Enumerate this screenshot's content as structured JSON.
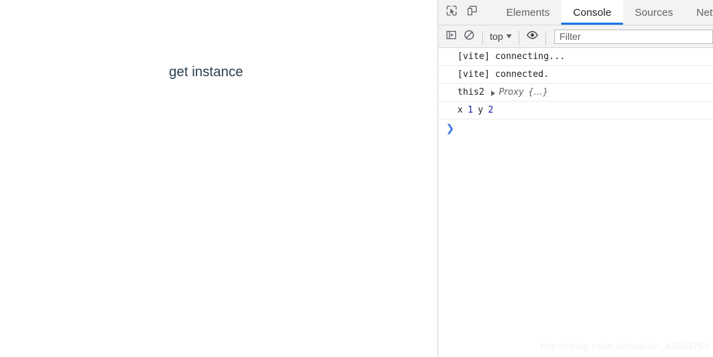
{
  "page": {
    "heading": "get instance",
    "background_color": "#ffffff",
    "heading_color": "#2c3e50"
  },
  "devtools": {
    "tabbar": {
      "inspect_icon": "inspect-element-icon",
      "device_toolbar_icon": "device-toolbar-icon",
      "tabs": [
        {
          "label": "Elements",
          "active": false
        },
        {
          "label": "Console",
          "active": true
        },
        {
          "label": "Sources",
          "active": false
        },
        {
          "label": "Netwo",
          "active": false
        }
      ],
      "active_tab_underline_color": "#1a73e8"
    },
    "console_toolbar": {
      "sidebar_toggle_icon": "console-sidebar-toggle-icon",
      "clear_console_icon": "clear-console-icon",
      "context_selector": {
        "value": "top",
        "caret_icon": "chevron-down-icon"
      },
      "live_expression_icon": "eye-icon",
      "filter": {
        "value": "",
        "placeholder": "Filter"
      }
    },
    "console_messages": [
      {
        "type": "log",
        "text": "[vite] connecting..."
      },
      {
        "type": "log",
        "text": "[vite] connected."
      },
      {
        "type": "object",
        "label": "this2",
        "disclosure_icon": "triangle-right-icon",
        "object_name": "Proxy",
        "object_preview": "{…}"
      },
      {
        "type": "values",
        "parts": [
          {
            "text": "x",
            "kind": "text"
          },
          {
            "text": "1",
            "kind": "number"
          },
          {
            "text": "y",
            "kind": "text"
          },
          {
            "text": "2",
            "kind": "number"
          }
        ]
      }
    ],
    "prompt": {
      "caret": "❯",
      "caret_color": "#3b78e7",
      "value": ""
    }
  },
  "watermark": {
    "text": "https://blog.csdn.net/weixin_44803753",
    "color": "#f2f2f2"
  }
}
